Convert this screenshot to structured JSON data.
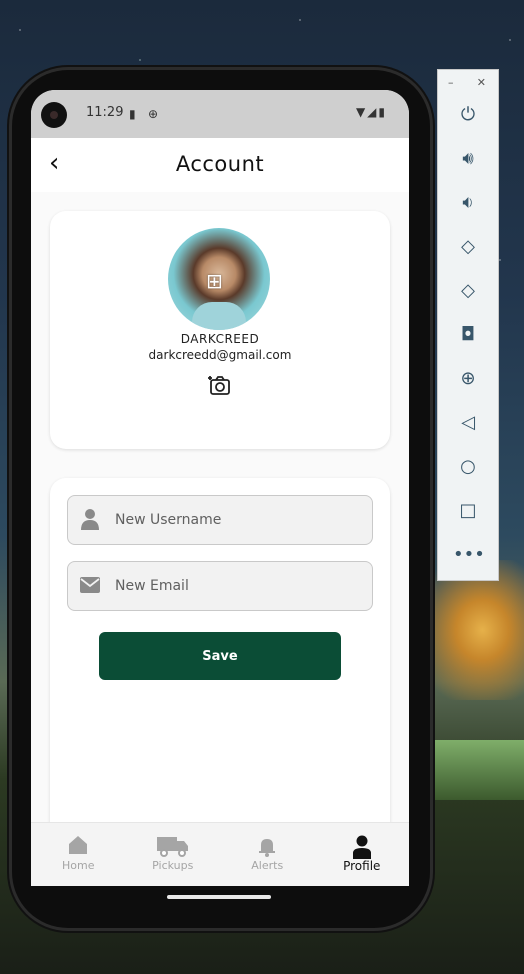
{
  "status_bar": {
    "time": "11:29"
  },
  "app_bar": {
    "title": "Account",
    "back_icon": "chevron-left-icon"
  },
  "profile": {
    "username": "DARKCREED",
    "email": "darkcreedd@gmail.com",
    "avatar_overlay_icon": "add-photo-icon",
    "change_photo_icon": "add-photo-icon"
  },
  "form": {
    "username_placeholder": "New Username",
    "email_placeholder": "New Email",
    "save_label": "Save"
  },
  "colors": {
    "primary": "#0b4d36",
    "nav_active": "#111111",
    "nav_inactive": "#a5a5a5"
  },
  "nav": {
    "items": [
      {
        "label": "Home",
        "icon": "home-icon"
      },
      {
        "label": "Pickups",
        "icon": "truck-icon"
      },
      {
        "label": "Alerts",
        "icon": "bell-icon"
      },
      {
        "label": "Profile",
        "icon": "person-icon"
      }
    ],
    "active": "Profile"
  },
  "emulator_panel": {
    "buttons": [
      "power-icon",
      "volume-up-icon",
      "volume-down-icon",
      "rotate-left-icon",
      "rotate-right-icon",
      "screenshot-icon",
      "zoom-icon",
      "back-icon",
      "home-icon",
      "overview-icon",
      "more-icon"
    ]
  }
}
